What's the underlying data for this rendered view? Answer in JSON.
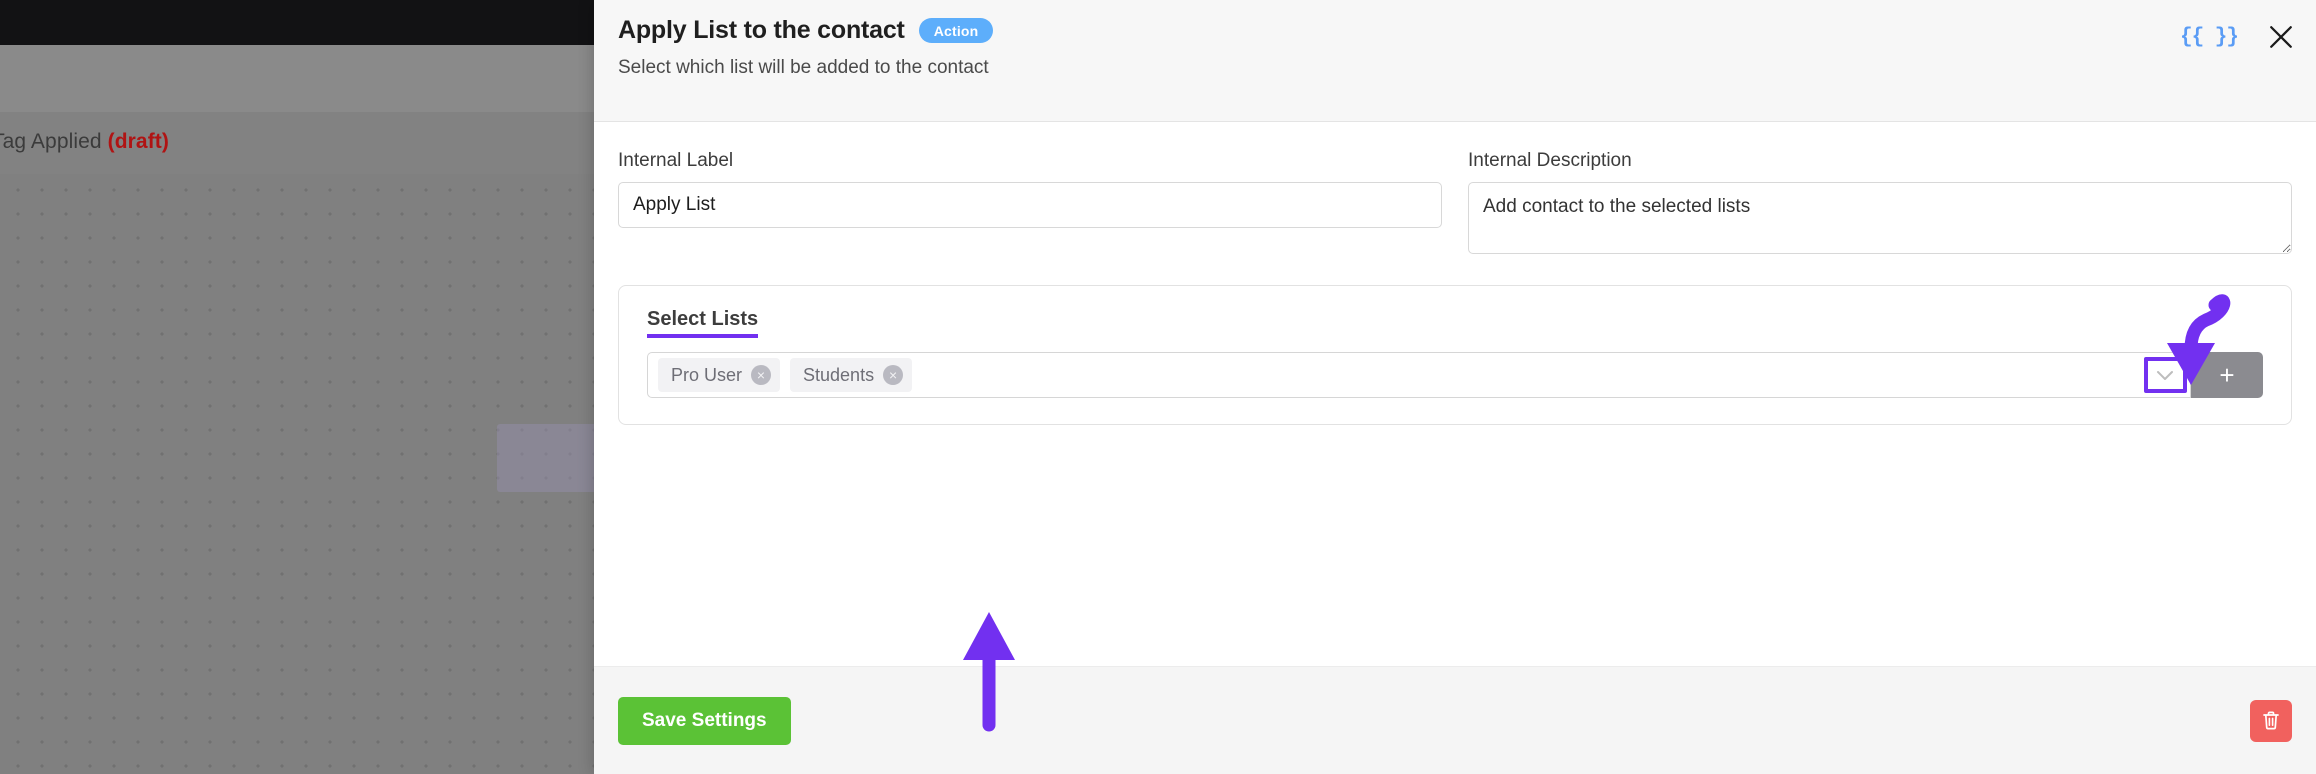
{
  "background": {
    "node_label_prefix": "Tag Applied ",
    "node_label_state": "(draft)"
  },
  "panel": {
    "title": "Apply List to the contact",
    "badge": "Action",
    "subtitle": "Select which list will be added to the contact",
    "code_icon_glyph": "{{ }}",
    "close_icon_name": "close-icon"
  },
  "form": {
    "internal_label": {
      "label": "Internal Label",
      "value": "Apply List",
      "placeholder": "Internal Label"
    },
    "internal_description": {
      "label": "Internal Description",
      "value": "Add contact to the selected lists",
      "placeholder": "Internal Description"
    }
  },
  "select_lists": {
    "legend": "Select Lists",
    "tags": [
      {
        "label": "Pro User",
        "remove_glyph": "×"
      },
      {
        "label": "Students",
        "remove_glyph": "×"
      }
    ],
    "dropdown_icon": "chevron-down-icon",
    "add_button_label": "+"
  },
  "footer": {
    "save_label": "Save Settings",
    "delete_icon": "trash-icon"
  },
  "colors": {
    "accent_purple": "#7230f0",
    "badge_blue": "#5daefb",
    "save_green": "#5bc236",
    "delete_red": "#f1615e",
    "draft_red": "#b01313",
    "code_icon_blue": "#5a9cf5"
  }
}
